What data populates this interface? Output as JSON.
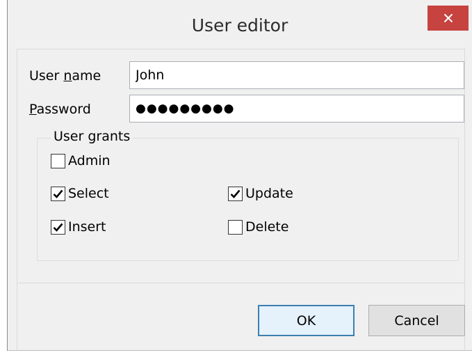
{
  "window": {
    "title": "User editor"
  },
  "form": {
    "username_label_pre": "User ",
    "username_label_accel": "n",
    "username_label_post": "ame",
    "username_value": "John",
    "password_label_accel": "P",
    "password_label_post": "assword",
    "password_mask": "●●●●●●●●●"
  },
  "grants": {
    "legend": "User grants",
    "items": [
      {
        "label": "Admin",
        "checked": false
      },
      {
        "label": "Select",
        "checked": true
      },
      {
        "label": "Update",
        "checked": true
      },
      {
        "label": "Insert",
        "checked": true
      },
      {
        "label": "Delete",
        "checked": false
      }
    ]
  },
  "buttons": {
    "ok": "OK",
    "cancel": "Cancel"
  },
  "icons": {
    "close": "close-icon",
    "check": "checkmark-icon"
  },
  "colors": {
    "close_bg": "#c74340",
    "default_button_border": "#3c7fb1",
    "window_bg": "#f0f0f0"
  }
}
